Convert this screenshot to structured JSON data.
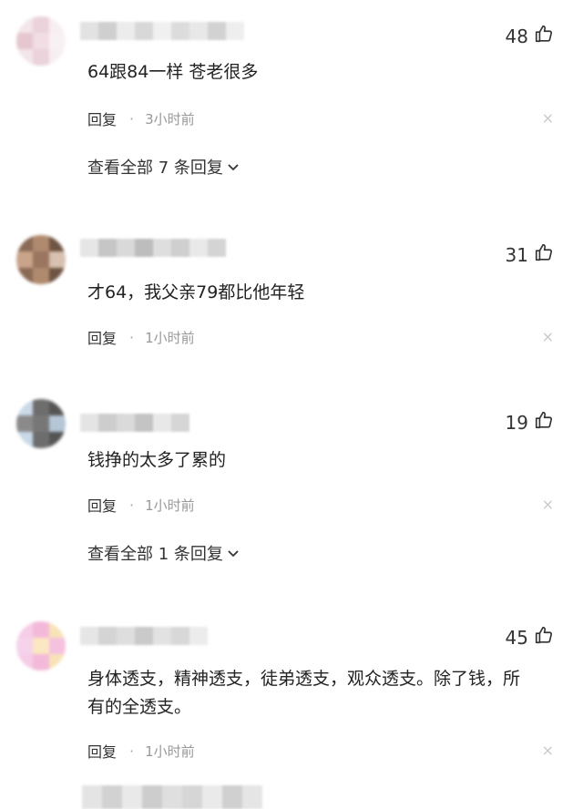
{
  "comments": [
    {
      "likes": "48",
      "text": "64跟84一样 苍老很多",
      "reply_label": "回复",
      "dot": "·",
      "time": "3小时前",
      "close": "×",
      "more_label": "查看全部 7 条回复",
      "avatar_colors": [
        "#f3e6ea",
        "#ead3da",
        "#f7eef1",
        "#e6c7cf",
        "#f1dde3",
        "#f8f1f3"
      ],
      "name_colors": [
        "#e2e2e2",
        "#cfcfcf",
        "#ececec",
        "#d8d8d8",
        "#f0f0f0",
        "#dcdcdc",
        "#e8e8e8",
        "#d2d2d2",
        "#eeeeee"
      ]
    },
    {
      "likes": "31",
      "text": "才64，我父亲79都比他年轻",
      "reply_label": "回复",
      "dot": "·",
      "time": "1小时前",
      "close": "×",
      "avatar_colors": [
        "#8a6a55",
        "#b08a6f",
        "#6f5443",
        "#c9a48a",
        "#9a7560",
        "#d8c1b0"
      ],
      "name_colors": [
        "#e6e6e6",
        "#c6c6c6",
        "#d9d9d9",
        "#bdbdbd",
        "#dedede",
        "#cfcfcf",
        "#e9e9e9",
        "#d4d4d4"
      ]
    },
    {
      "likes": "19",
      "text": "钱挣的太多了累的",
      "reply_label": "回复",
      "dot": "·",
      "time": "1小时前",
      "close": "×",
      "more_label": "查看全部 1 条回复",
      "avatar_colors": [
        "#c9d9e8",
        "#6d6d6d",
        "#555555",
        "#8a8a8a",
        "#777777",
        "#b5c6d6"
      ],
      "name_colors": [
        "#e4e4e4",
        "#cdcdcd",
        "#dadada",
        "#c4c4c4",
        "#e8e8e8",
        "#d6d6d6"
      ]
    },
    {
      "likes": "45",
      "text": "身体透支，精神透支，徒弟透支，观众透支。除了钱，所有的全透支。",
      "reply_label": "回复",
      "dot": "·",
      "time": "1小时前",
      "close": "×",
      "avatar_colors": [
        "#f6cde6",
        "#f3b9d9",
        "#f8e3b8",
        "#f5d3ea",
        "#fbe7c2",
        "#f4c2de"
      ],
      "name_colors": [
        "#e6e6e6",
        "#d4d4d4",
        "#dedede",
        "#cacaca",
        "#e2e2e2",
        "#d8d8d8",
        "#ececec"
      ]
    }
  ],
  "partial_comment": {
    "name_colors": [
      "#e4e4e4",
      "#d2d2d2",
      "#e9e9e9",
      "#cdcdcd",
      "#dfdfdf",
      "#d6d6d6",
      "#eaeaea",
      "#d0d0d0",
      "#e5e5e5"
    ]
  },
  "icons": {
    "like": "thumbs-up-icon",
    "close": "close-icon",
    "expand": "chevron-down-icon"
  }
}
